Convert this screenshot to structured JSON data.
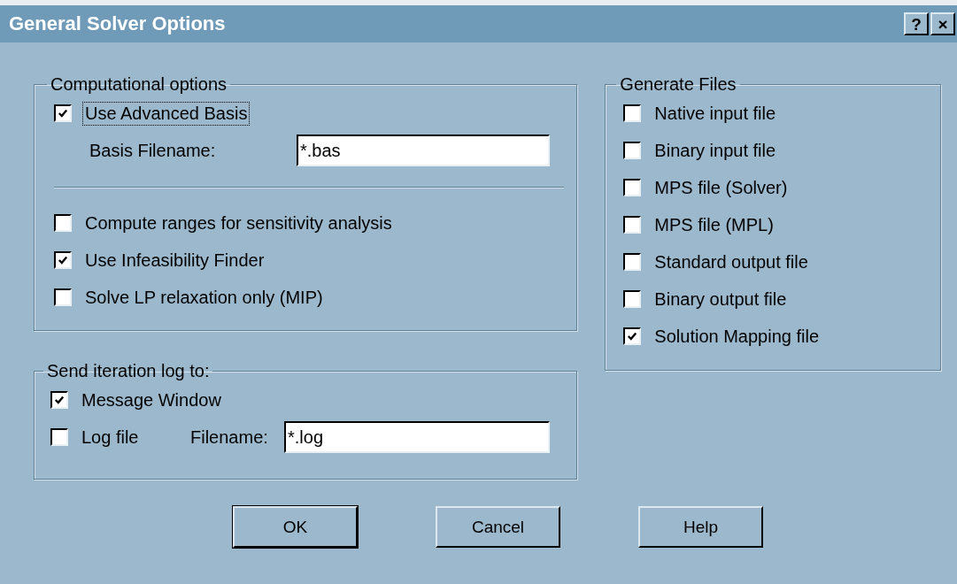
{
  "window": {
    "title": "General Solver Options",
    "title_buttons": [
      "?",
      "×"
    ]
  },
  "computational": {
    "title": "Computational options",
    "advanced": {
      "label": "Use Advanced Basis",
      "checked": true,
      "focused": true
    },
    "basis_field": {
      "label": "Basis Filename:",
      "value": "*.bas"
    },
    "options": [
      {
        "label": "Compute ranges for sensitivity analysis",
        "checked": false
      },
      {
        "label": "Use Infeasibility Finder",
        "checked": true
      },
      {
        "label": "Solve LP relaxation only (MIP)",
        "checked": false
      }
    ]
  },
  "iteration_log": {
    "title": "Send iteration log to:",
    "message_window": {
      "label": "Message Window",
      "checked": true
    },
    "log_file": {
      "label": "Log file",
      "checked": false
    },
    "filename": {
      "label": "Filename:",
      "value": "*.log"
    }
  },
  "generate_files": {
    "title": "Generate Files",
    "items": [
      {
        "label": "Native input file",
        "checked": false
      },
      {
        "label": "Binary input file",
        "checked": false
      },
      {
        "label": "MPS file (Solver)",
        "checked": false
      },
      {
        "label": "MPS file (MPL)",
        "checked": false
      },
      {
        "label": "Standard output file",
        "checked": false
      },
      {
        "label": "Binary output file",
        "checked": false
      },
      {
        "label": "Solution Mapping file",
        "checked": true
      }
    ]
  },
  "buttons": [
    {
      "label": "OK",
      "default": true
    },
    {
      "label": "Cancel",
      "default": false
    },
    {
      "label": "Help",
      "default": false
    }
  ]
}
